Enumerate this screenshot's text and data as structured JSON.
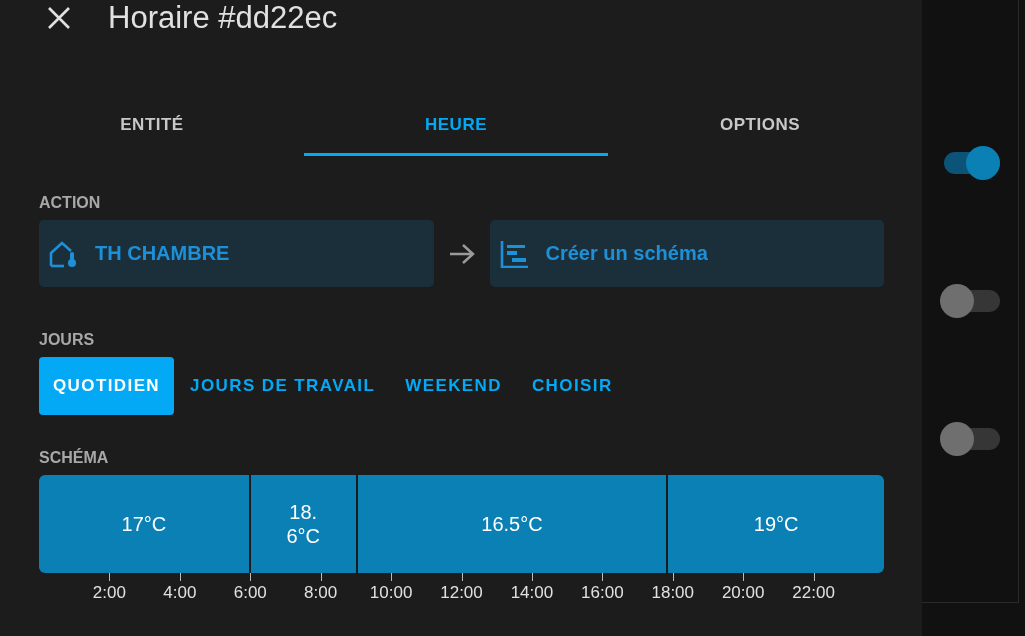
{
  "dialog": {
    "title": "Horaire #dd22ec"
  },
  "tabs": [
    {
      "label": "ENTITÉ",
      "selected": false
    },
    {
      "label": "HEURE",
      "selected": true
    },
    {
      "label": "OPTIONS",
      "selected": false
    }
  ],
  "action": {
    "label": "ACTION",
    "entity": "TH CHAMBRE",
    "service": "Créer un schéma"
  },
  "days": {
    "label": "JOURS",
    "options": [
      {
        "label": "QUOTIDIEN",
        "selected": true
      },
      {
        "label": "JOURS DE TRAVAIL",
        "selected": false
      },
      {
        "label": "WEEKEND",
        "selected": false
      },
      {
        "label": "CHOISIR",
        "selected": false
      }
    ]
  },
  "schema": {
    "label": "SCHÉMA",
    "segments": [
      {
        "text": "17°C"
      },
      {
        "text": "18.\n6°C"
      },
      {
        "text": "16.5°C"
      },
      {
        "text": "19°C"
      }
    ],
    "ticks": [
      "2:00",
      "4:00",
      "6:00",
      "8:00",
      "10:00",
      "12:00",
      "14:00",
      "16:00",
      "18:00",
      "20:00",
      "22:00"
    ]
  },
  "side_toggles": [
    {
      "on": true
    },
    {
      "on": false
    },
    {
      "on": false
    }
  ]
}
